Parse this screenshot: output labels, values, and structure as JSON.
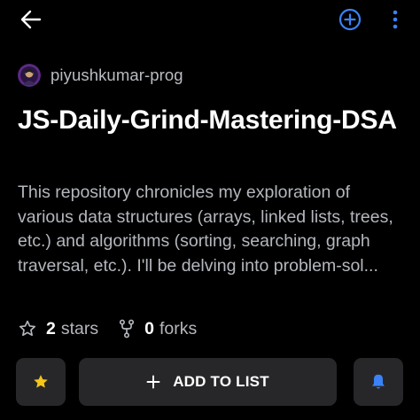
{
  "header": {
    "back_icon": "arrow-left-icon",
    "add_icon": "plus-circle-icon",
    "more_icon": "kebab-menu-icon"
  },
  "repo": {
    "owner": "piyushkumar-prog",
    "title": "JS-Daily-Grind-Mastering-DSA",
    "description": "This repository chronicles my exploration of various data structures (arrays, linked lists, trees, etc.) and algorithms (sorting, searching, graph traversal, etc.). I'll be delving into problem-sol..."
  },
  "stats": {
    "stars_count": "2",
    "stars_label": "stars",
    "forks_count": "0",
    "forks_label": "forks"
  },
  "actions": {
    "add_to_list_label": "ADD TO LIST",
    "star_icon": "star-filled-icon",
    "notify_icon": "bell-icon"
  },
  "colors": {
    "background": "#000000",
    "accent_blue": "#3b82f6",
    "star_yellow": "#f5c518",
    "muted_text": "#b4b7bd",
    "button_bg": "#27272a"
  }
}
